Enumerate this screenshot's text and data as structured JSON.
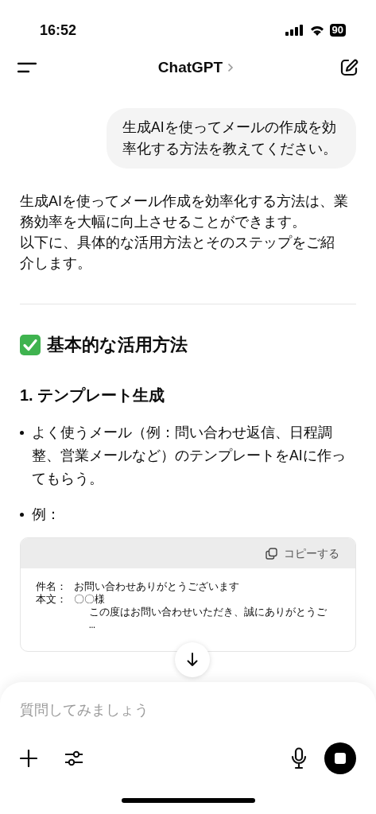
{
  "status_bar": {
    "time": "16:52",
    "battery": "90"
  },
  "header": {
    "title": "ChatGPT"
  },
  "user_message": {
    "text": "生成AIを使ってメールの作成を効率化する方法を教えてください。"
  },
  "response": {
    "intro": [
      "生成AIを使ってメール作成を効率化する方法は、業務効率を大幅に向上させることができます。",
      "以下に、具体的な活用方法とそのステップをご紹介します。"
    ],
    "heading": "基本的な活用方法",
    "subheading": "1. テンプレート生成",
    "bullets": [
      "よく使うメール（例：問い合わせ返信、日程調整、営業メールなど）のテンプレートをAIに作ってもらう。",
      "例："
    ],
    "code_block": {
      "copy_label": "コピーする",
      "lines": [
        {
          "label": "件名：",
          "text": "お問い合わせありがとうございます"
        },
        {
          "label": "本文：",
          "text": "〇〇様"
        },
        {
          "text": "この度はお問い合わせいただき、誠にありがとうご"
        },
        {
          "text": "…"
        }
      ]
    }
  },
  "composer": {
    "placeholder": "質問してみましょう"
  }
}
